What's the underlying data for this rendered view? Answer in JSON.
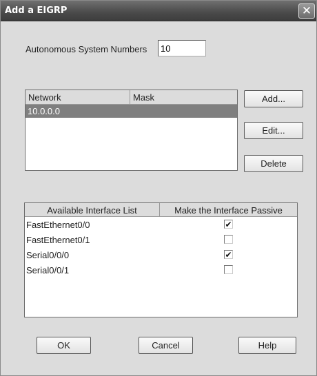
{
  "window": {
    "title": "Add a EIGRP",
    "close_glyph": "✕"
  },
  "asn": {
    "label": "Autonomous System Numbers",
    "value": "10"
  },
  "network_table": {
    "columns": [
      "Network",
      "Mask"
    ],
    "rows": [
      {
        "network": "10.0.0.0",
        "mask": "",
        "selected": true
      }
    ]
  },
  "side_buttons": {
    "add": "Add...",
    "edit": "Edit...",
    "delete": "Delete"
  },
  "interface_table": {
    "columns": [
      "Available Interface List",
      "Make the Interface Passive"
    ],
    "rows": [
      {
        "name": "FastEthernet0/0",
        "passive": true,
        "check": "✔"
      },
      {
        "name": "FastEthernet0/1",
        "passive": false,
        "check": ""
      },
      {
        "name": "Serial0/0/0",
        "passive": true,
        "check": "✔"
      },
      {
        "name": "Serial0/0/1",
        "passive": false,
        "check": ""
      }
    ]
  },
  "footer_buttons": {
    "ok": "OK",
    "cancel": "Cancel",
    "help": "Help"
  }
}
